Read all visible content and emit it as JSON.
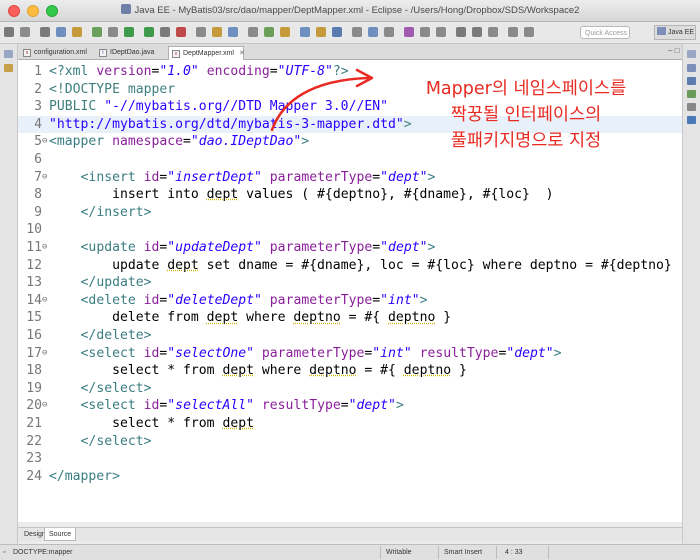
{
  "window": {
    "title": "Java EE - MyBatis03/src/dao/mapper/DeptMapper.xml - Eclipse - /Users/Hong/Dropbox/SDS/Workspace2"
  },
  "toolbar": {
    "quick_access_placeholder": "Quick Access",
    "perspective_label": "Java EE"
  },
  "tabs": [
    {
      "label": "configuration.xml",
      "icon": "xml-file-icon",
      "active": false
    },
    {
      "label": "IDeptDao.java",
      "icon": "java-interface-icon",
      "active": false
    },
    {
      "label": "DeptMapper.xml",
      "icon": "xml-file-icon",
      "active": true
    }
  ],
  "editor": {
    "highlighted_line": 4,
    "lines": [
      {
        "n": "1",
        "fold": "",
        "code": [
          [
            "pi",
            "<?xml "
          ],
          [
            "a",
            "version"
          ],
          [
            "p",
            "="
          ],
          [
            "v",
            "\"1.0\""
          ],
          [
            "p",
            " "
          ],
          [
            "a",
            "encoding"
          ],
          [
            "p",
            "="
          ],
          [
            "v",
            "\"UTF-8\""
          ],
          [
            "pi",
            "?>"
          ]
        ]
      },
      {
        "n": "2",
        "fold": "",
        "code": [
          [
            "dt",
            "<!DOCTYPE mapper"
          ]
        ]
      },
      {
        "n": "3",
        "fold": "",
        "code": [
          [
            "dt",
            "PUBLIC "
          ],
          [
            "ds",
            "\"-//mybatis.org//DTD Mapper 3.0//EN\""
          ]
        ]
      },
      {
        "n": "4",
        "fold": "",
        "code": [
          [
            "ds",
            "\"http://mybatis.org/dtd/mybatis-3-mapper.dtd\""
          ],
          [
            "dt",
            ">"
          ]
        ]
      },
      {
        "n": "5",
        "fold": "⊖",
        "code": [
          [
            "t",
            "<mapper "
          ],
          [
            "a",
            "namespace"
          ],
          [
            "p",
            "="
          ],
          [
            "v",
            "\"dao.IDeptDao\""
          ],
          [
            "t",
            ">"
          ]
        ]
      },
      {
        "n": "6",
        "fold": "",
        "code": []
      },
      {
        "n": "7",
        "fold": "⊖",
        "code": [
          [
            "p",
            "    "
          ],
          [
            "t",
            "<insert "
          ],
          [
            "a",
            "id"
          ],
          [
            "p",
            "="
          ],
          [
            "v",
            "\"insertDept\""
          ],
          [
            "p",
            " "
          ],
          [
            "a",
            "parameterType"
          ],
          [
            "p",
            "="
          ],
          [
            "v",
            "\"dept\""
          ],
          [
            "t",
            ">"
          ]
        ]
      },
      {
        "n": "8",
        "fold": "",
        "code": [
          [
            "p",
            "        insert into "
          ],
          [
            "u",
            "dept"
          ],
          [
            "p",
            " values ( #{deptno}, #{dname}, #{loc}  )"
          ]
        ]
      },
      {
        "n": "9",
        "fold": "",
        "code": [
          [
            "p",
            "    "
          ],
          [
            "t",
            "</insert>"
          ]
        ]
      },
      {
        "n": "10",
        "fold": "",
        "code": []
      },
      {
        "n": "11",
        "fold": "⊖",
        "code": [
          [
            "p",
            "    "
          ],
          [
            "t",
            "<update "
          ],
          [
            "a",
            "id"
          ],
          [
            "p",
            "="
          ],
          [
            "v",
            "\"updateDept\""
          ],
          [
            "p",
            " "
          ],
          [
            "a",
            "parameterType"
          ],
          [
            "p",
            "="
          ],
          [
            "v",
            "\"dept\""
          ],
          [
            "t",
            ">"
          ]
        ]
      },
      {
        "n": "12",
        "fold": "",
        "code": [
          [
            "p",
            "        update "
          ],
          [
            "u",
            "dept"
          ],
          [
            "p",
            " set dname = #{dname}, loc = #{loc} where deptno = #{deptno}"
          ]
        ]
      },
      {
        "n": "13",
        "fold": "",
        "code": [
          [
            "p",
            "    "
          ],
          [
            "t",
            "</update>"
          ]
        ]
      },
      {
        "n": "14",
        "fold": "⊖",
        "code": [
          [
            "p",
            "    "
          ],
          [
            "t",
            "<delete "
          ],
          [
            "a",
            "id"
          ],
          [
            "p",
            "="
          ],
          [
            "v",
            "\"deleteDept\""
          ],
          [
            "p",
            " "
          ],
          [
            "a",
            "parameterType"
          ],
          [
            "p",
            "="
          ],
          [
            "v",
            "\"int\""
          ],
          [
            "t",
            ">"
          ]
        ]
      },
      {
        "n": "15",
        "fold": "",
        "code": [
          [
            "p",
            "        delete from "
          ],
          [
            "u",
            "dept"
          ],
          [
            "p",
            " where "
          ],
          [
            "u",
            "deptno"
          ],
          [
            "p",
            " = #{ "
          ],
          [
            "u",
            "deptno"
          ],
          [
            "p",
            " }"
          ]
        ]
      },
      {
        "n": "16",
        "fold": "",
        "code": [
          [
            "p",
            "    "
          ],
          [
            "t",
            "</delete>"
          ]
        ]
      },
      {
        "n": "17",
        "fold": "⊖",
        "code": [
          [
            "p",
            "    "
          ],
          [
            "t",
            "<select "
          ],
          [
            "a",
            "id"
          ],
          [
            "p",
            "="
          ],
          [
            "v",
            "\"selectOne\""
          ],
          [
            "p",
            " "
          ],
          [
            "a",
            "parameterType"
          ],
          [
            "p",
            "="
          ],
          [
            "v",
            "\"int\""
          ],
          [
            "p",
            " "
          ],
          [
            "a",
            "resultType"
          ],
          [
            "p",
            "="
          ],
          [
            "v",
            "\"dept\""
          ],
          [
            "t",
            ">"
          ]
        ]
      },
      {
        "n": "18",
        "fold": "",
        "code": [
          [
            "p",
            "        select * from "
          ],
          [
            "u",
            "dept"
          ],
          [
            "p",
            " where "
          ],
          [
            "u",
            "deptno"
          ],
          [
            "p",
            " = #{ "
          ],
          [
            "u",
            "deptno"
          ],
          [
            "p",
            " }"
          ]
        ]
      },
      {
        "n": "19",
        "fold": "",
        "code": [
          [
            "p",
            "    "
          ],
          [
            "t",
            "</select>"
          ]
        ]
      },
      {
        "n": "20",
        "fold": "⊖",
        "code": [
          [
            "p",
            "    "
          ],
          [
            "t",
            "<select "
          ],
          [
            "a",
            "id"
          ],
          [
            "p",
            "="
          ],
          [
            "v",
            "\"selectAll\""
          ],
          [
            "p",
            " "
          ],
          [
            "a",
            "resultType"
          ],
          [
            "p",
            "="
          ],
          [
            "v",
            "\"dept\""
          ],
          [
            "t",
            ">"
          ]
        ]
      },
      {
        "n": "21",
        "fold": "",
        "code": [
          [
            "p",
            "        select * from "
          ],
          [
            "u",
            "dept"
          ]
        ]
      },
      {
        "n": "22",
        "fold": "",
        "code": [
          [
            "p",
            "    "
          ],
          [
            "t",
            "</select>"
          ]
        ]
      },
      {
        "n": "23",
        "fold": "",
        "code": []
      },
      {
        "n": "24",
        "fold": "",
        "code": [
          [
            "t",
            "</mapper>"
          ]
        ]
      }
    ]
  },
  "annotation": {
    "lines": [
      "Mapper의 네임스페이스를",
      "짝꿍될 인터페이스의",
      "풀패키지명으로 지정"
    ],
    "color": "#e82a22"
  },
  "bottom_tabs": [
    {
      "label": "Design",
      "active": false
    },
    {
      "label": "Source",
      "active": true
    }
  ],
  "status": {
    "path": "DOCTYPE:mapper",
    "mode": "Writable",
    "insert_mode": "Smart Insert",
    "position": "4 : 33"
  }
}
